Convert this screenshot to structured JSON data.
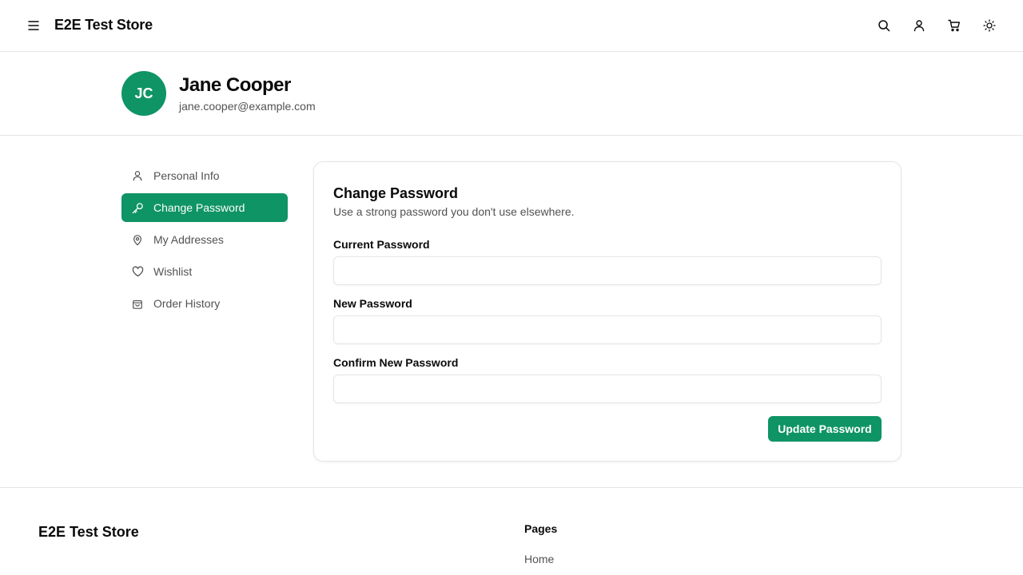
{
  "header": {
    "brand": "E2E Test Store",
    "icons": [
      "menu-icon",
      "search-icon",
      "user-icon",
      "cart-icon",
      "sun-icon"
    ]
  },
  "profile": {
    "initials": "JC",
    "name": "Jane Cooper",
    "email": "jane.cooper@example.com"
  },
  "sidebar": {
    "items": [
      {
        "label": "Personal Info",
        "icon": "user-icon",
        "active": false
      },
      {
        "label": "Change Password",
        "icon": "key-icon",
        "active": true
      },
      {
        "label": "My Addresses",
        "icon": "map-pin-icon",
        "active": false
      },
      {
        "label": "Wishlist",
        "icon": "heart-icon",
        "active": false
      },
      {
        "label": "Order History",
        "icon": "shopping-bag-icon",
        "active": false
      }
    ]
  },
  "form": {
    "title": "Change Password",
    "subtitle": "Use a strong password you don't use elsewhere.",
    "current_label": "Current Password",
    "current_value": "",
    "new_label": "New Password",
    "new_value": "",
    "confirm_label": "Confirm New Password",
    "confirm_value": "",
    "submit_label": "Update Password"
  },
  "footer": {
    "brand": "E2E Test Store",
    "pages_heading": "Pages",
    "links": [
      "Home"
    ]
  },
  "colors": {
    "accent": "#0f9465",
    "border": "#e5e5e5",
    "muted_text": "#525252"
  }
}
